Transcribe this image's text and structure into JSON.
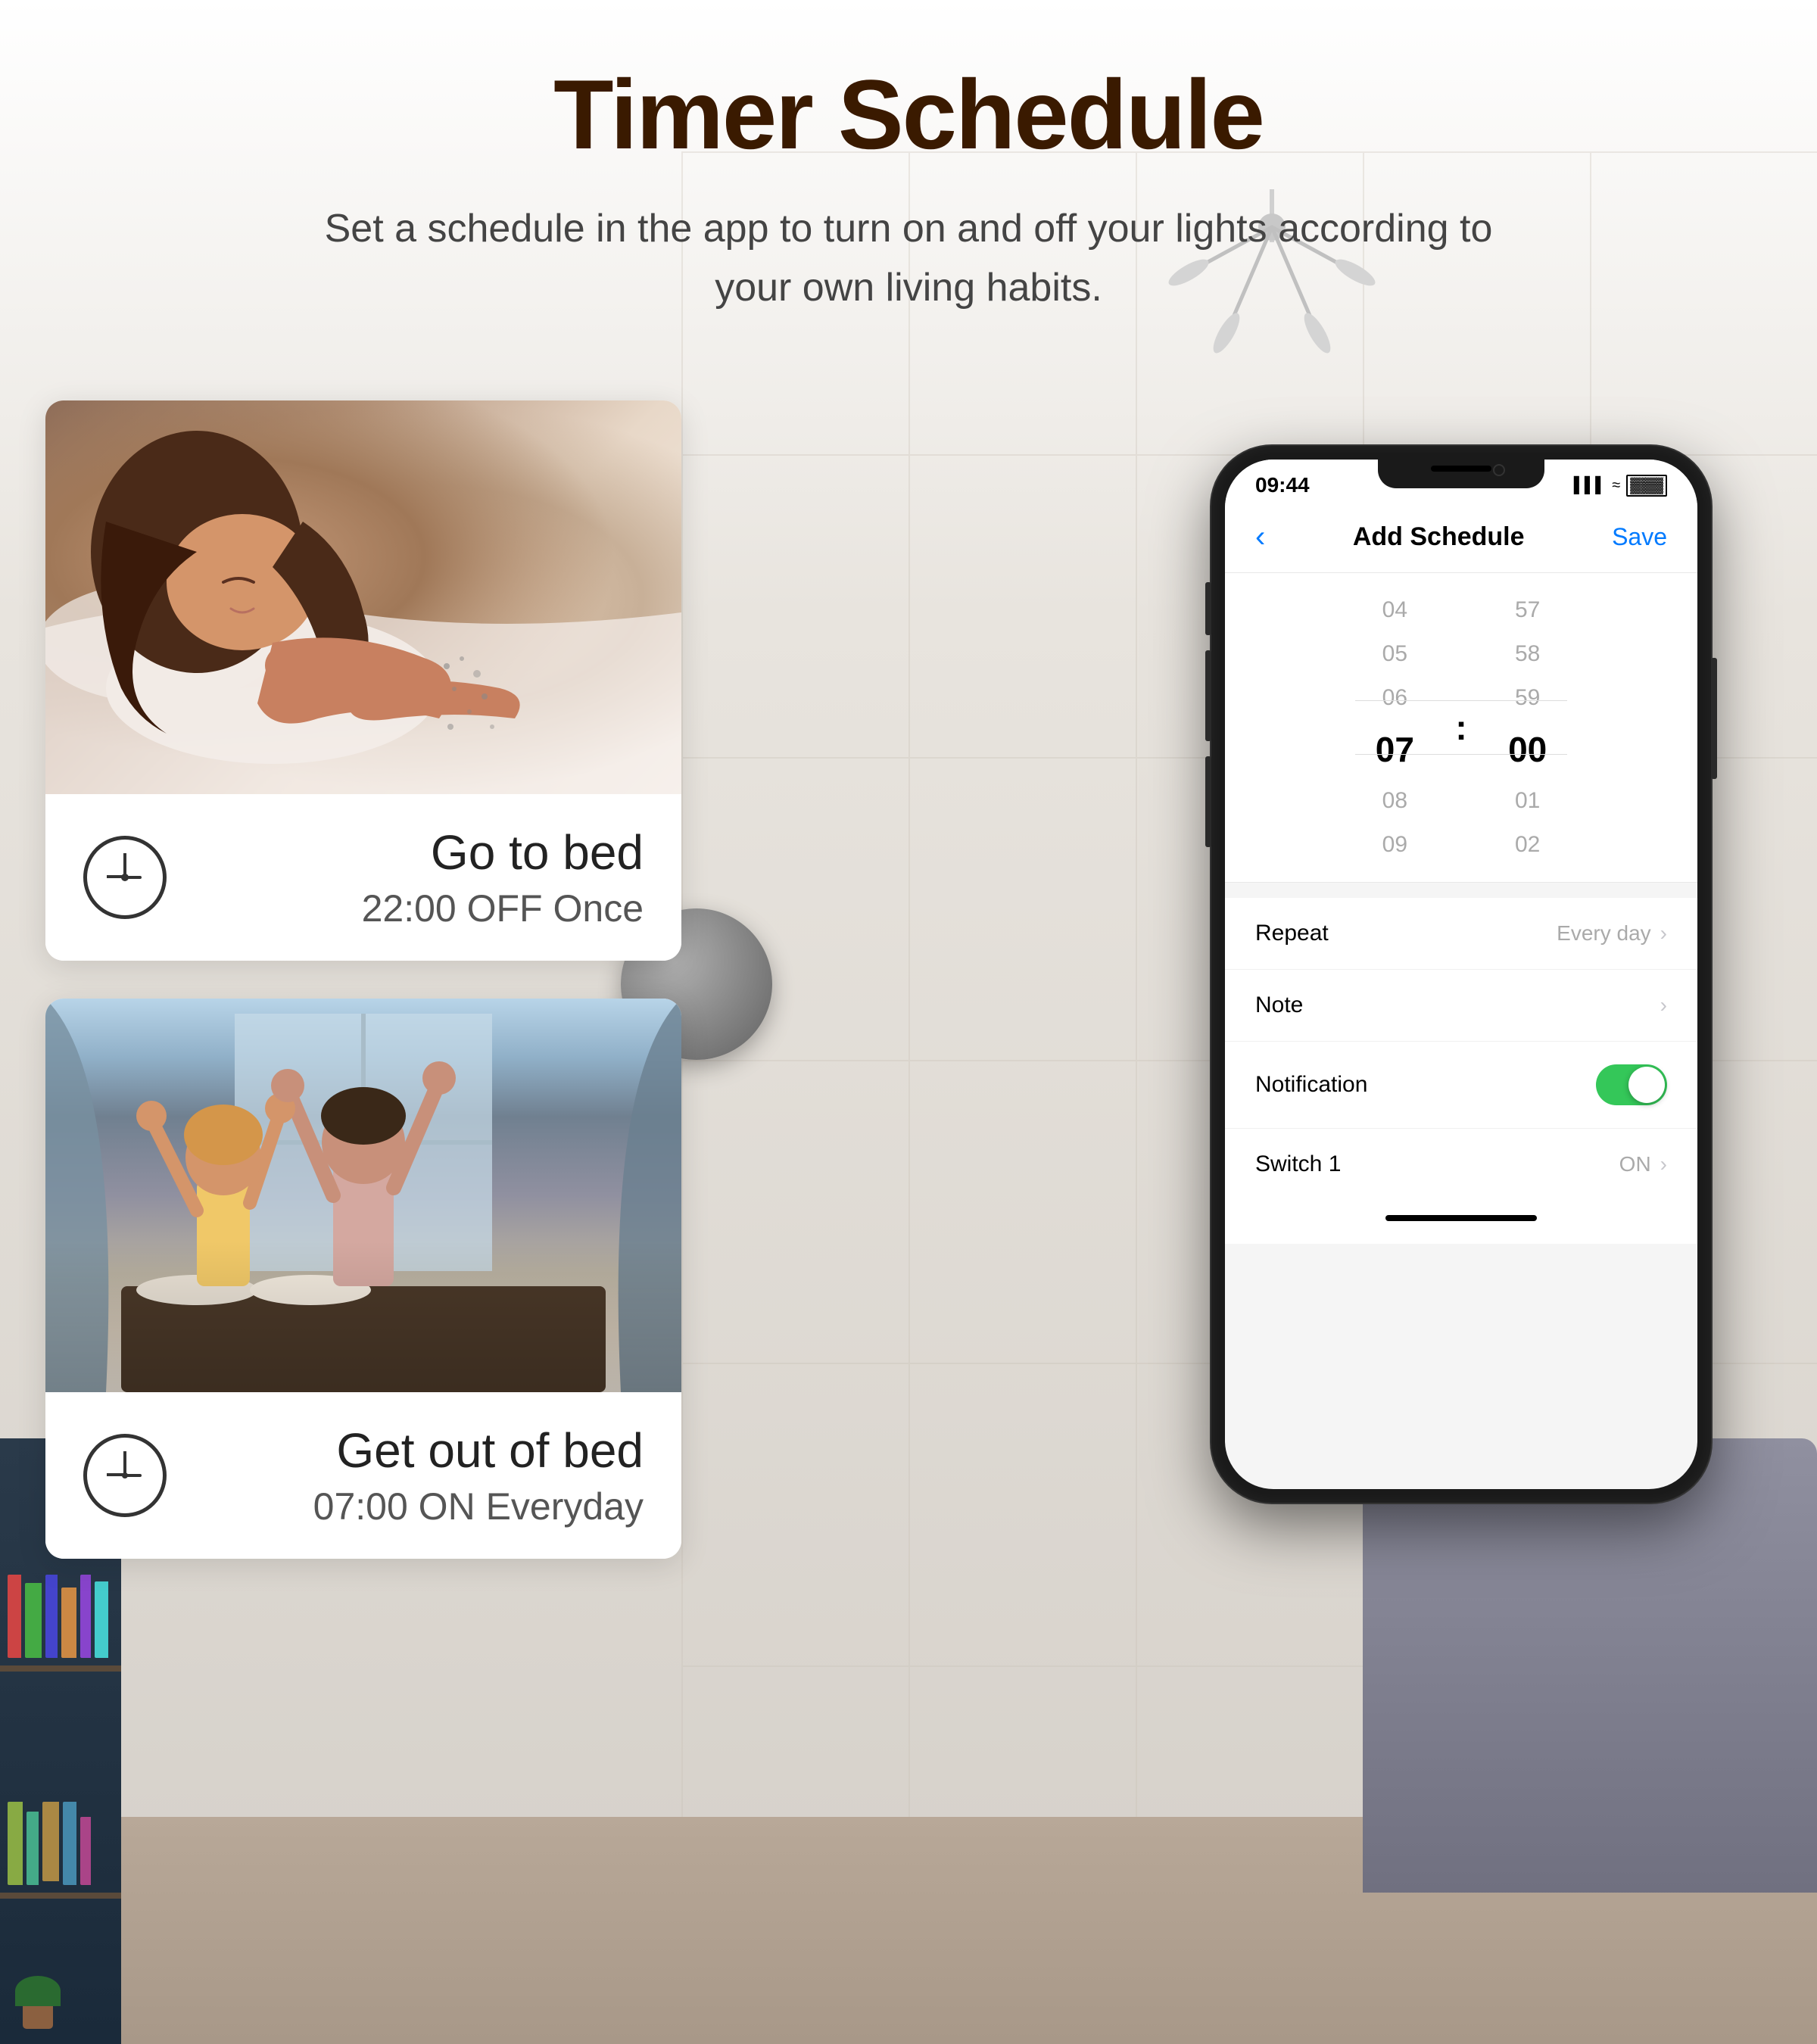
{
  "page": {
    "title": "Timer Schedule",
    "subtitle": "Set a schedule in the app to turn on and off your lights according to your own living habits."
  },
  "cards": [
    {
      "id": "card-sleep",
      "title": "Go to bed",
      "detail": "22:00 OFF Once"
    },
    {
      "id": "card-morning",
      "title": "Get out of bed",
      "detail": "07:00 ON Everyday"
    }
  ],
  "phone": {
    "status_bar": {
      "time": "09:44",
      "signal": "●●● ≈",
      "battery": "■"
    },
    "nav": {
      "back_label": "‹",
      "title": "Add Schedule",
      "save_label": "Save"
    },
    "time_picker": {
      "hours": [
        "04",
        "05",
        "06",
        "07",
        "08",
        "09"
      ],
      "minutes": [
        "57",
        "58",
        "59",
        "00",
        "01",
        "02"
      ],
      "selected_hour": "07",
      "selected_minute": "00"
    },
    "settings": [
      {
        "id": "repeat",
        "label": "Repeat",
        "value": "Every day",
        "has_chevron": true,
        "type": "text"
      },
      {
        "id": "note",
        "label": "Note",
        "value": "",
        "has_chevron": true,
        "type": "text"
      },
      {
        "id": "notification",
        "label": "Notification",
        "value": "",
        "has_chevron": false,
        "type": "toggle",
        "toggle_on": true
      },
      {
        "id": "switch1",
        "label": "Switch 1",
        "value": "ON",
        "has_chevron": true,
        "type": "text"
      }
    ]
  }
}
